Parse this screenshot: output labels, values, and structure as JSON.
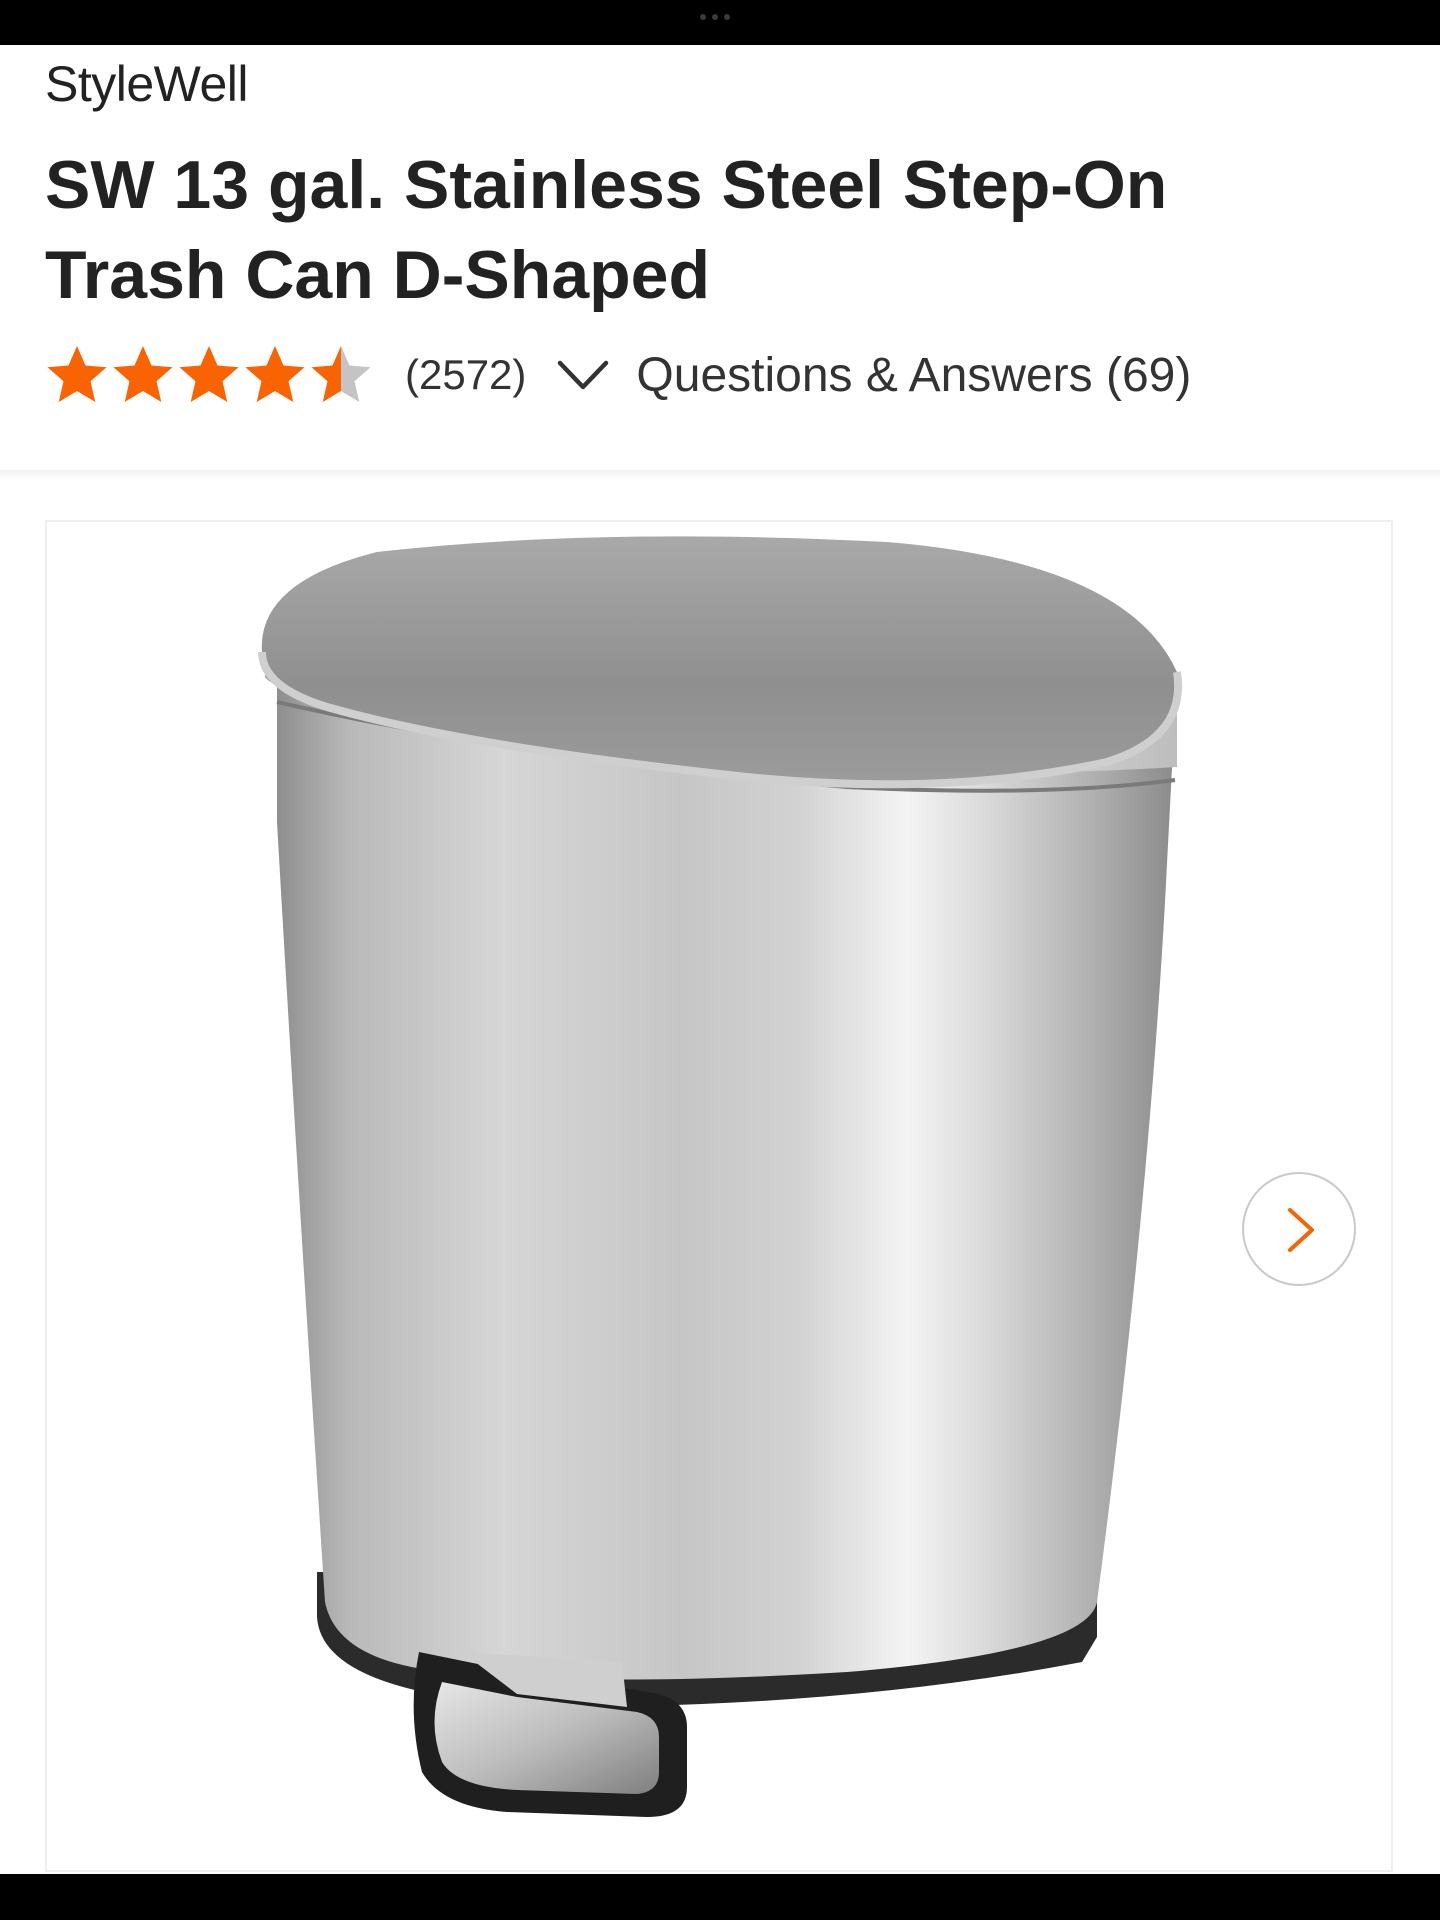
{
  "brand": "StyleWell",
  "title": "SW 13 gal. Stainless Steel Step-On Trash Can D-Shaped",
  "rating": {
    "value": 4.5,
    "max": 5,
    "count_label": "(2572)",
    "star_icon": "star-icon",
    "color_filled": "#f96302",
    "color_empty": "#c4c4c4"
  },
  "qa_label": "Questions & Answers (69)",
  "gallery": {
    "next_icon": "chevron-right-icon",
    "accent_color": "#f96302"
  }
}
